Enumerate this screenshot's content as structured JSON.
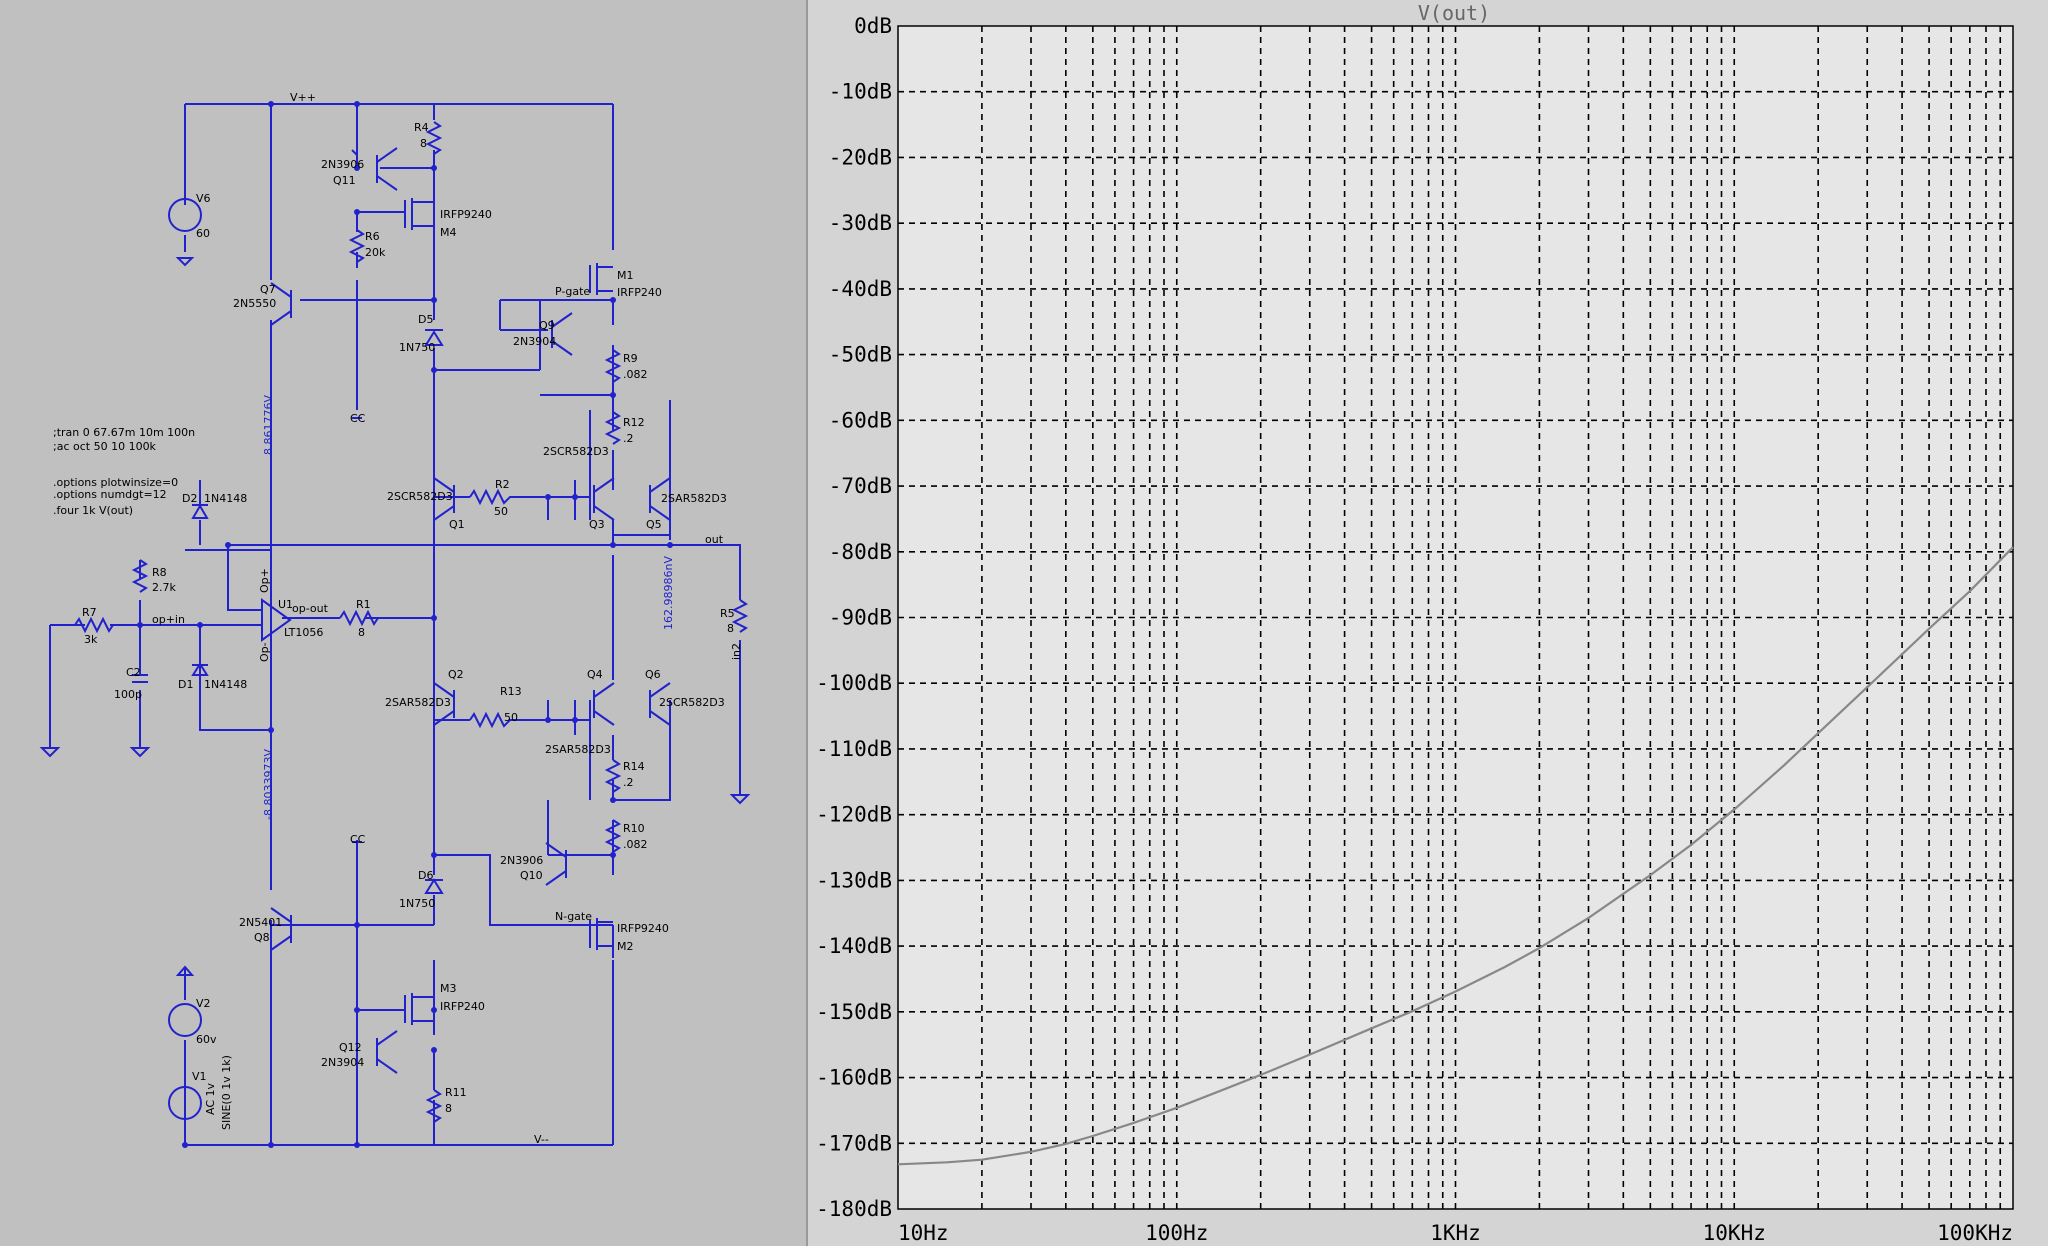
{
  "schematic": {
    "rails": {
      "vpp": "V++",
      "vmm": "V--",
      "out": "out",
      "cc": "CC",
      "in2": "in2"
    },
    "nets": {
      "pgate": "P-gate",
      "ngate": "N-gate",
      "opp": "Op+",
      "opm": "Op-",
      "opout": "op-out",
      "opin": "op+in"
    },
    "voltages": {
      "v1": "8.861776V",
      "v2": "162.98986nV",
      "v3": "-8.8033973V"
    },
    "directives": [
      ";tran 0 67.67m 10m 100n",
      ";ac oct 50 10 100k",
      ".options plotwinsize=0",
      ".options numdgt=12",
      ".four 1k V(out)"
    ],
    "components": {
      "v6": {
        "ref": "V6",
        "val": "60"
      },
      "v2": {
        "ref": "V2",
        "val": "60v"
      },
      "v1": {
        "ref": "V1",
        "val": "AC 1v",
        "val2": "SINE(0 1v 1k)"
      },
      "q11": {
        "ref": "Q11",
        "model": "2N3906"
      },
      "q7": {
        "ref": "Q7",
        "model": "2N5550"
      },
      "q8": {
        "ref": "Q8",
        "model": "2N5401"
      },
      "q12": {
        "ref": "Q12",
        "model": "2N3904"
      },
      "q9": {
        "ref": "Q9",
        "model": "2N3904"
      },
      "q10": {
        "ref": "Q10",
        "model": "2N3906"
      },
      "q1": {
        "ref": "Q1",
        "model": "2SCR582D3"
      },
      "q2": {
        "ref": "Q2",
        "model": "2SAR582D3"
      },
      "q3": {
        "ref": "Q3",
        "model": "2SCR582D3"
      },
      "q4": {
        "ref": "Q4",
        "model": "2SAR582D3"
      },
      "q5": {
        "ref": "Q5",
        "model": "2SAR582D3"
      },
      "q6": {
        "ref": "Q6",
        "model": "2SCR582D3"
      },
      "m4": {
        "ref": "M4",
        "model": "IRFP9240"
      },
      "m1": {
        "ref": "M1",
        "model": "IRFP240"
      },
      "m2": {
        "ref": "M2",
        "model": "IRFP9240"
      },
      "m3": {
        "ref": "M3",
        "model": "IRFP240"
      },
      "r4": {
        "ref": "R4",
        "val": "8"
      },
      "r6": {
        "ref": "R6",
        "val": "20k"
      },
      "r9": {
        "ref": "R9",
        "val": ".082"
      },
      "r12": {
        "ref": "R12",
        "val": ".2"
      },
      "r2": {
        "ref": "R2",
        "val": "50"
      },
      "r13": {
        "ref": "R13",
        "val": "50"
      },
      "r14": {
        "ref": "R14",
        "val": ".2"
      },
      "r10": {
        "ref": "R10",
        "val": ".082"
      },
      "r11": {
        "ref": "R11",
        "val": "8"
      },
      "r8": {
        "ref": "R8",
        "val": "2.7k"
      },
      "r7": {
        "ref": "R7",
        "val": "3k"
      },
      "r1": {
        "ref": "R1",
        "val": "8"
      },
      "r5": {
        "ref": "R5",
        "val": "8"
      },
      "c2": {
        "ref": "C2",
        "val": "100p"
      },
      "d5": {
        "ref": "D5",
        "model": "1N750"
      },
      "d6": {
        "ref": "D6",
        "model": "1N750"
      },
      "d2": {
        "ref": "D2",
        "model": "1N4148"
      },
      "d1": {
        "ref": "D1",
        "model": "1N4148"
      },
      "u1": {
        "ref": "U1",
        "model": "LT1056"
      }
    }
  },
  "chart_data": {
    "type": "line",
    "title": "V(out)",
    "xscale": "log",
    "xlim": [
      10,
      100000
    ],
    "ylim": [
      -180,
      0
    ],
    "xticks": [
      "10Hz",
      "100Hz",
      "1KHz",
      "10KHz",
      "100KHz"
    ],
    "yticks": [
      "0dB",
      "-10dB",
      "-20dB",
      "-30dB",
      "-40dB",
      "-50dB",
      "-60dB",
      "-70dB",
      "-80dB",
      "-90dB",
      "-100dB",
      "-110dB",
      "-120dB",
      "-130dB",
      "-140dB",
      "-150dB",
      "-160dB",
      "-170dB",
      "-180dB"
    ],
    "grid": true,
    "series": [
      {
        "name": "V(out)",
        "color": "#888888",
        "x": [
          10,
          15,
          20,
          30,
          40,
          50,
          70,
          100,
          150,
          200,
          300,
          500,
          700,
          1000,
          1500,
          2000,
          3000,
          5000,
          7000,
          10000,
          15000,
          20000,
          30000,
          50000,
          70000,
          100000
        ],
        "y": [
          -173.2,
          -172.9,
          -172.5,
          -171.3,
          -170.1,
          -168.9,
          -166.9,
          -164.6,
          -161.7,
          -159.6,
          -156.5,
          -152.5,
          -149.9,
          -146.9,
          -143.2,
          -140.3,
          -135.7,
          -129.2,
          -124.6,
          -119.2,
          -112.6,
          -107.6,
          -100.6,
          -91.7,
          -86.0,
          -79.3
        ]
      }
    ]
  }
}
